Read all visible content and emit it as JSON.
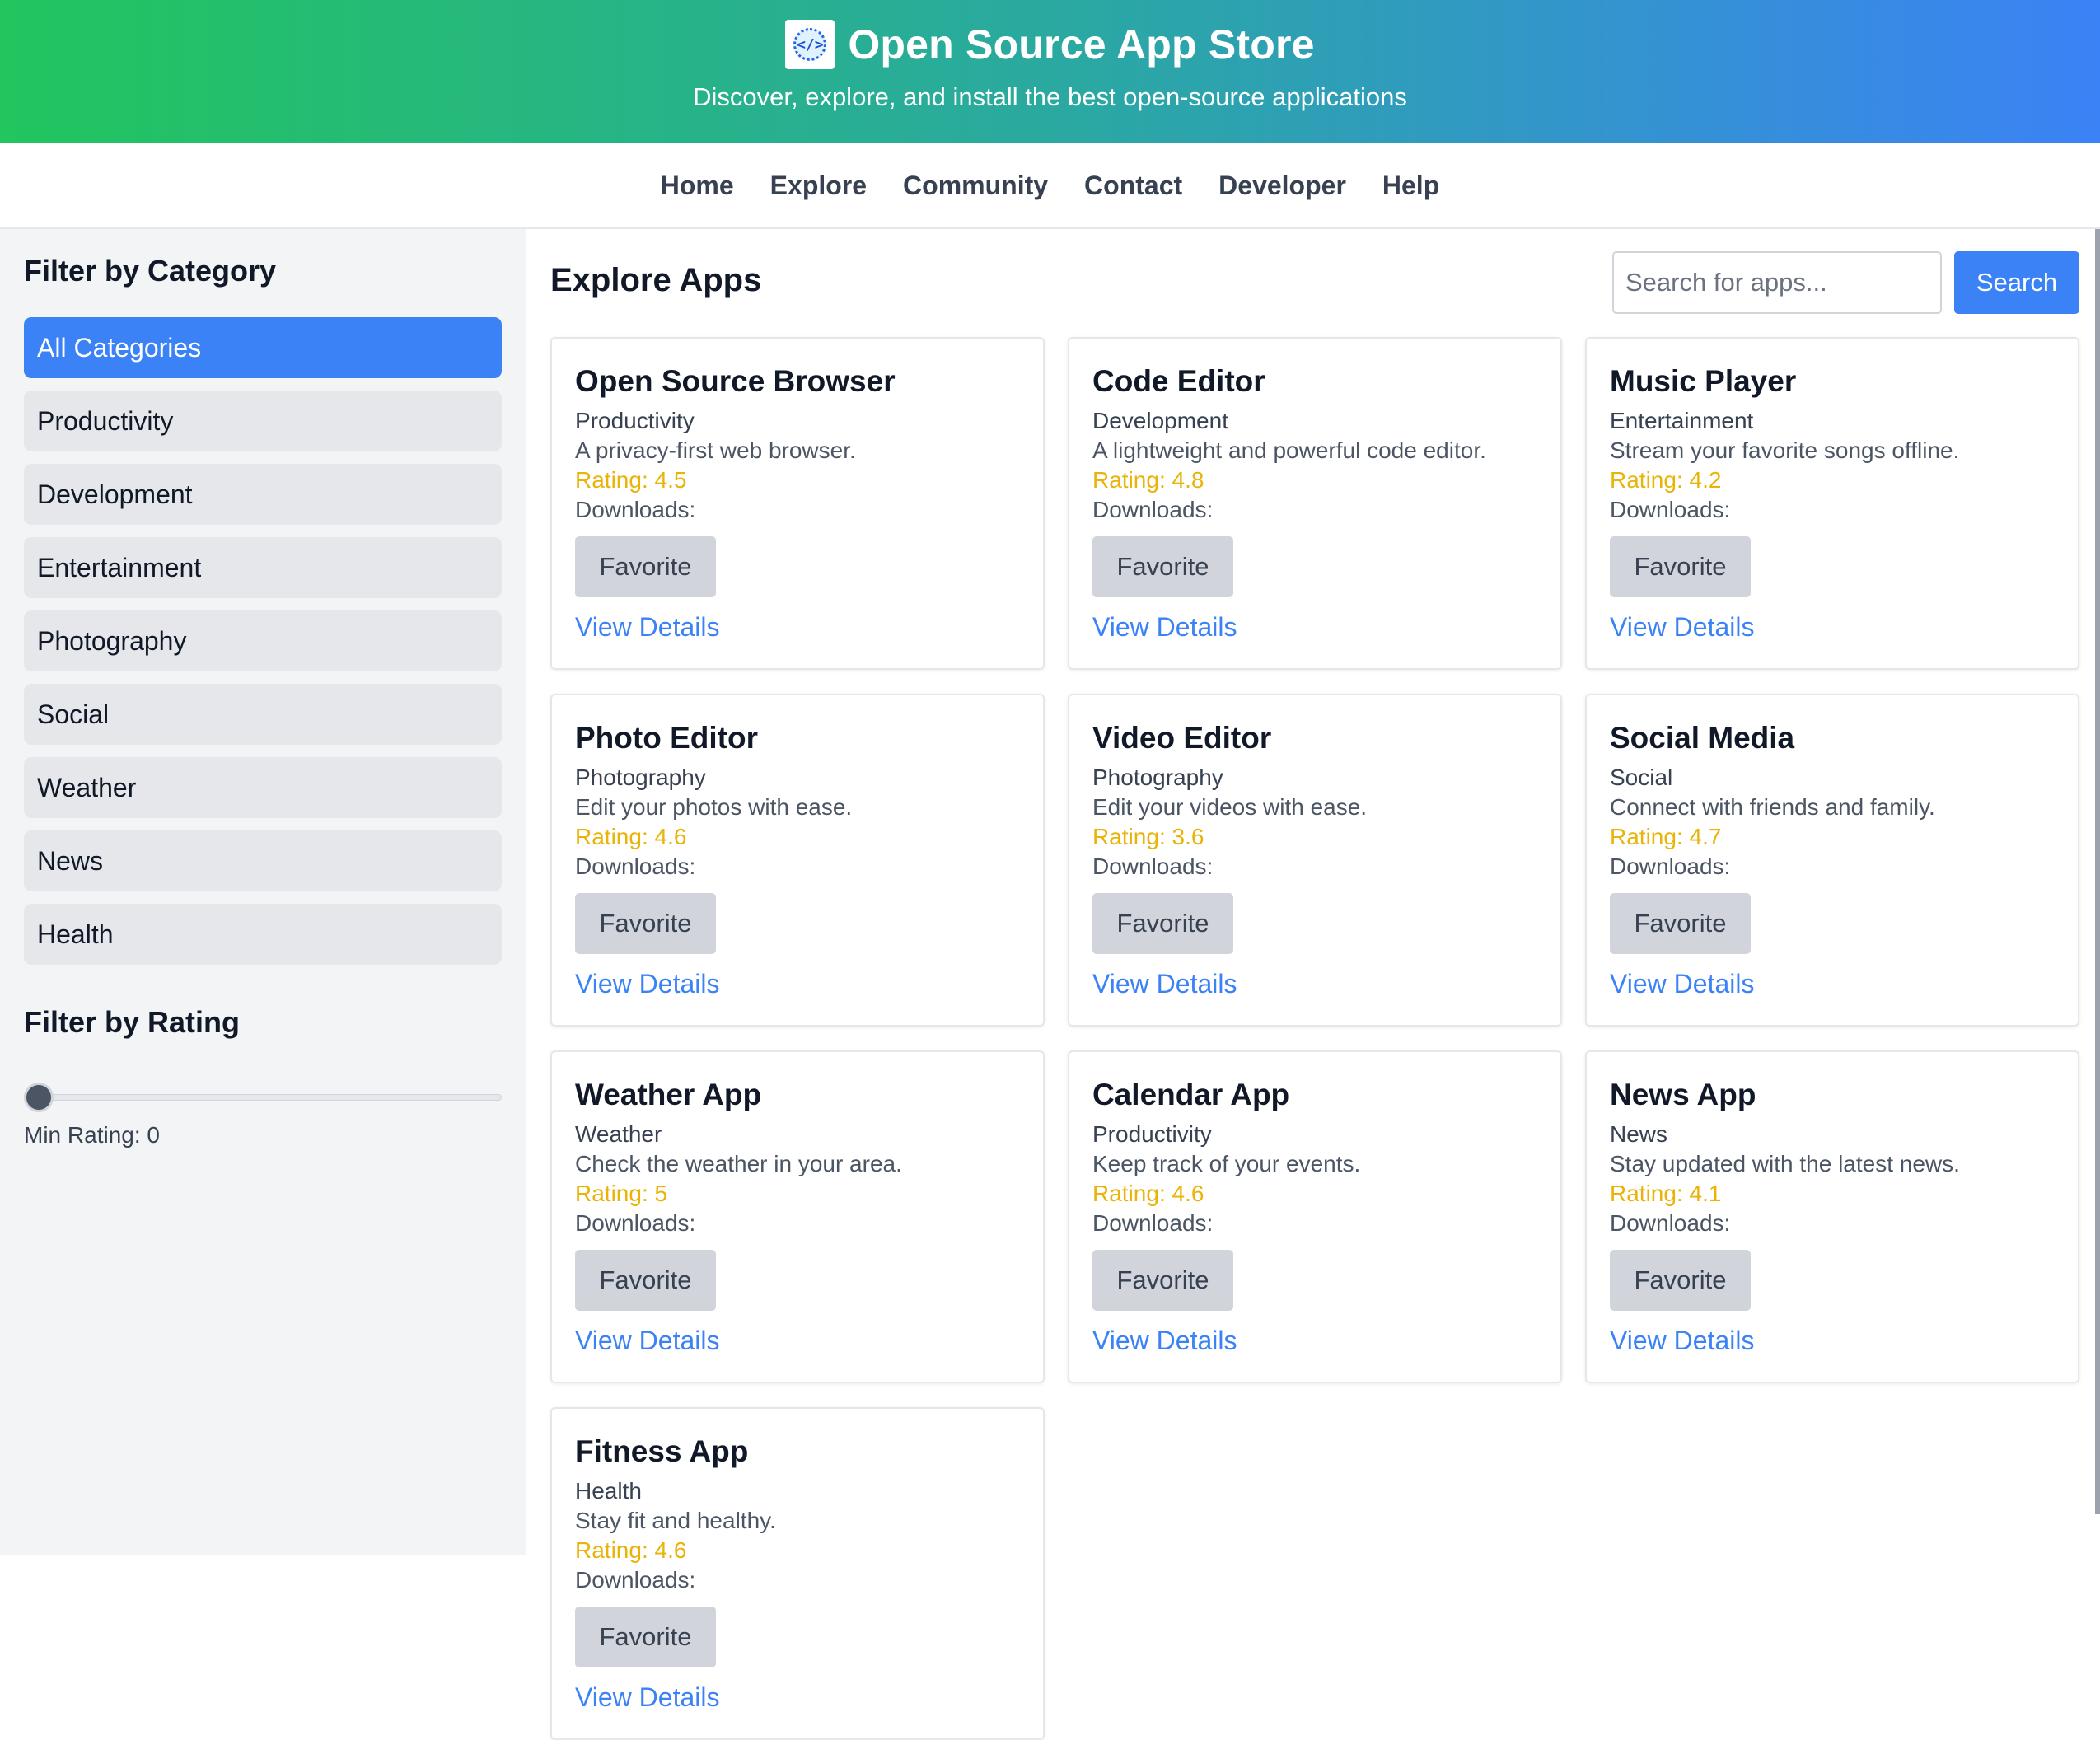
{
  "header": {
    "title": "Open Source App Store",
    "subtitle": "Discover, explore, and install the best open-source applications",
    "logo_icon": "app-store-logo-icon"
  },
  "nav": {
    "items": [
      "Home",
      "Explore",
      "Community",
      "Contact",
      "Developer",
      "Help"
    ]
  },
  "sidebar": {
    "category_heading": "Filter by Category",
    "categories": [
      "All Categories",
      "Productivity",
      "Development",
      "Entertainment",
      "Photography",
      "Social",
      "Weather",
      "News",
      "Health"
    ],
    "active_category": "All Categories",
    "rating_heading": "Filter by Rating",
    "min_rating_label": "Min Rating: 0",
    "min_rating_value": 0
  },
  "main": {
    "title": "Explore Apps",
    "search_placeholder": "Search for apps...",
    "search_button": "Search",
    "favorite_label": "Favorite",
    "details_label": "View Details",
    "apps": [
      {
        "name": "Open Source Browser",
        "category": "Productivity",
        "description": "A privacy-first web browser.",
        "rating": "Rating: 4.5",
        "downloads": "Downloads:"
      },
      {
        "name": "Code Editor",
        "category": "Development",
        "description": "A lightweight and powerful code editor.",
        "rating": "Rating: 4.8",
        "downloads": "Downloads:"
      },
      {
        "name": "Music Player",
        "category": "Entertainment",
        "description": "Stream your favorite songs offline.",
        "rating": "Rating: 4.2",
        "downloads": "Downloads:"
      },
      {
        "name": "Photo Editor",
        "category": "Photography",
        "description": "Edit your photos with ease.",
        "rating": "Rating: 4.6",
        "downloads": "Downloads:"
      },
      {
        "name": "Video Editor",
        "category": "Photography",
        "description": "Edit your videos with ease.",
        "rating": "Rating: 3.6",
        "downloads": "Downloads:"
      },
      {
        "name": "Social Media",
        "category": "Social",
        "description": "Connect with friends and family.",
        "rating": "Rating: 4.7",
        "downloads": "Downloads:"
      },
      {
        "name": "Weather App",
        "category": "Weather",
        "description": "Check the weather in your area.",
        "rating": "Rating: 5",
        "downloads": "Downloads:"
      },
      {
        "name": "Calendar App",
        "category": "Productivity",
        "description": "Keep track of your events.",
        "rating": "Rating: 4.6",
        "downloads": "Downloads:"
      },
      {
        "name": "News App",
        "category": "News",
        "description": "Stay updated with the latest news.",
        "rating": "Rating: 4.1",
        "downloads": "Downloads:"
      },
      {
        "name": "Fitness App",
        "category": "Health",
        "description": "Stay fit and healthy.",
        "rating": "Rating: 4.6",
        "downloads": "Downloads:"
      }
    ]
  },
  "colors": {
    "header_gradient_start": "#22c55e",
    "header_gradient_end": "#3b82f6",
    "accent": "#3b82f6",
    "rating": "#eab308"
  }
}
